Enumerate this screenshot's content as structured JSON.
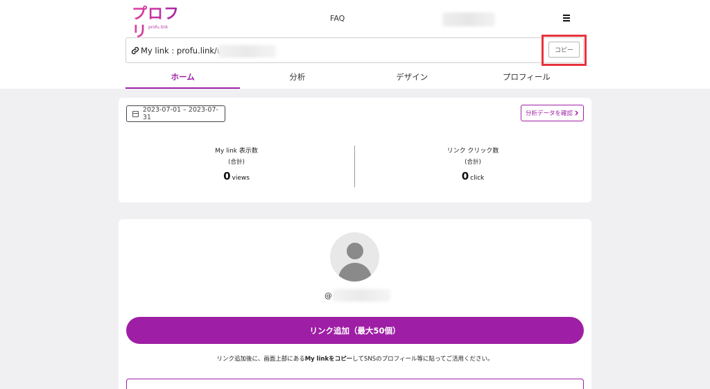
{
  "header": {
    "logo_text": "プロフリ",
    "logo_sub": "profu.link",
    "faq": "FAQ"
  },
  "mylink": {
    "label": "My link : profu.link/u/",
    "copy_label": "コピー"
  },
  "tabs": [
    {
      "label": "ホーム",
      "active": true
    },
    {
      "label": "分析",
      "active": false
    },
    {
      "label": "デザイン",
      "active": false
    },
    {
      "label": "プロフィール",
      "active": false
    }
  ],
  "stats_card": {
    "date_range": "2023-07-01 – 2023-07-31",
    "analysis_button": "分析データを確認",
    "views": {
      "title": "My link 表示数",
      "sub": "(合計)",
      "value": "0",
      "unit": "views"
    },
    "clicks": {
      "title": "リンク クリック数",
      "sub": "(合計)",
      "value": "0",
      "unit": "click"
    }
  },
  "profile_card": {
    "handle_prefix": "@",
    "add_link_button": "リンク追加（最大50個）",
    "hint_before": "リンク追加後に、画面上部にある",
    "hint_bold": "My linkをコピー",
    "hint_after": "してSNSのプロフィール等に貼ってご活用ください。"
  },
  "colors": {
    "accent": "#9e1fa5",
    "highlight": "#e8323c",
    "background": "#f0eff2"
  }
}
